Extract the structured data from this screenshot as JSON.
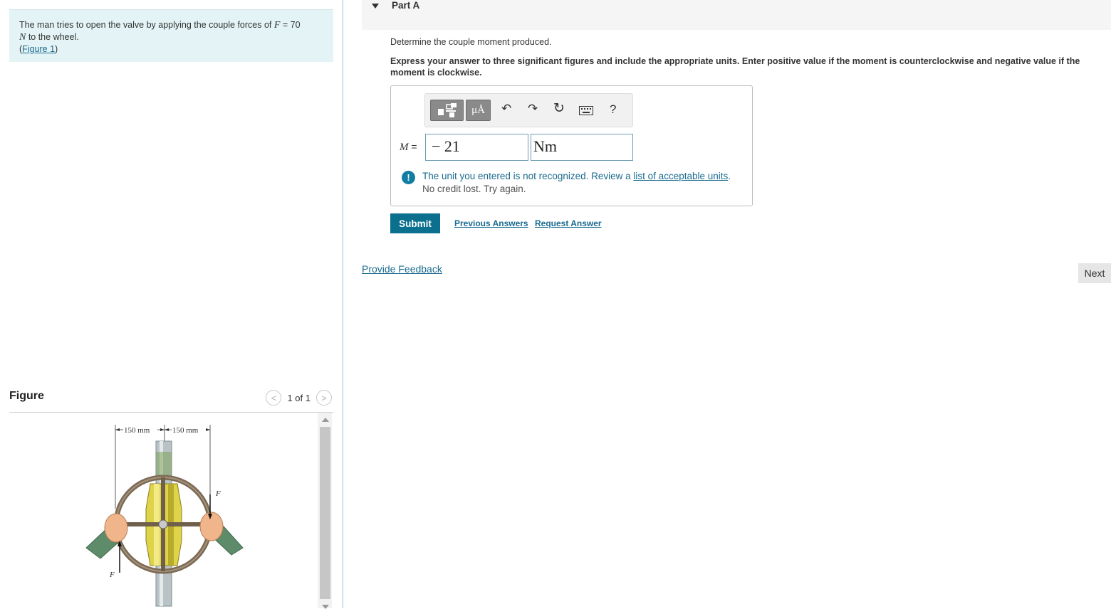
{
  "problem": {
    "text_before": "The man tries to open the valve by applying the couple forces of ",
    "force_var": "F",
    "force_value": " = 70",
    "unit_var": "N",
    "text_after": " to the wheel.",
    "figure_open": "(",
    "figure_link": "Figure 1",
    "figure_close": ")"
  },
  "figure": {
    "title": "Figure",
    "pager_text": "1 of 1",
    "dim_left": "150 mm",
    "dim_right": "150 mm",
    "force_label_top": "F",
    "force_label_bottom": "F"
  },
  "part": {
    "title": "Part A",
    "question": "Determine the couple moment produced.",
    "instruction": "Express your answer to three significant figures and include the appropriate units. Enter positive value if the moment is counterclockwise and negative value if the moment is clockwise."
  },
  "answer": {
    "var_label": "M",
    "equals": " =",
    "value": "− 21",
    "unit": "Nm",
    "toolbar_units_label": "μÅ",
    "toolbar_help": "?"
  },
  "feedback": {
    "line1_before": "The unit you entered is not recognized. Review a ",
    "line1_link": "list of acceptable units",
    "line1_after": ".",
    "line2": "No credit lost. Try again."
  },
  "actions": {
    "submit": "Submit",
    "previous_answers": "Previous Answers",
    "request_answer": "Request Answer",
    "provide_feedback": "Provide Feedback",
    "next": "Next"
  },
  "colors": {
    "accent": "#0b6f8e",
    "problem_bg": "#e4f4f6",
    "link": "#1a6b8f"
  }
}
